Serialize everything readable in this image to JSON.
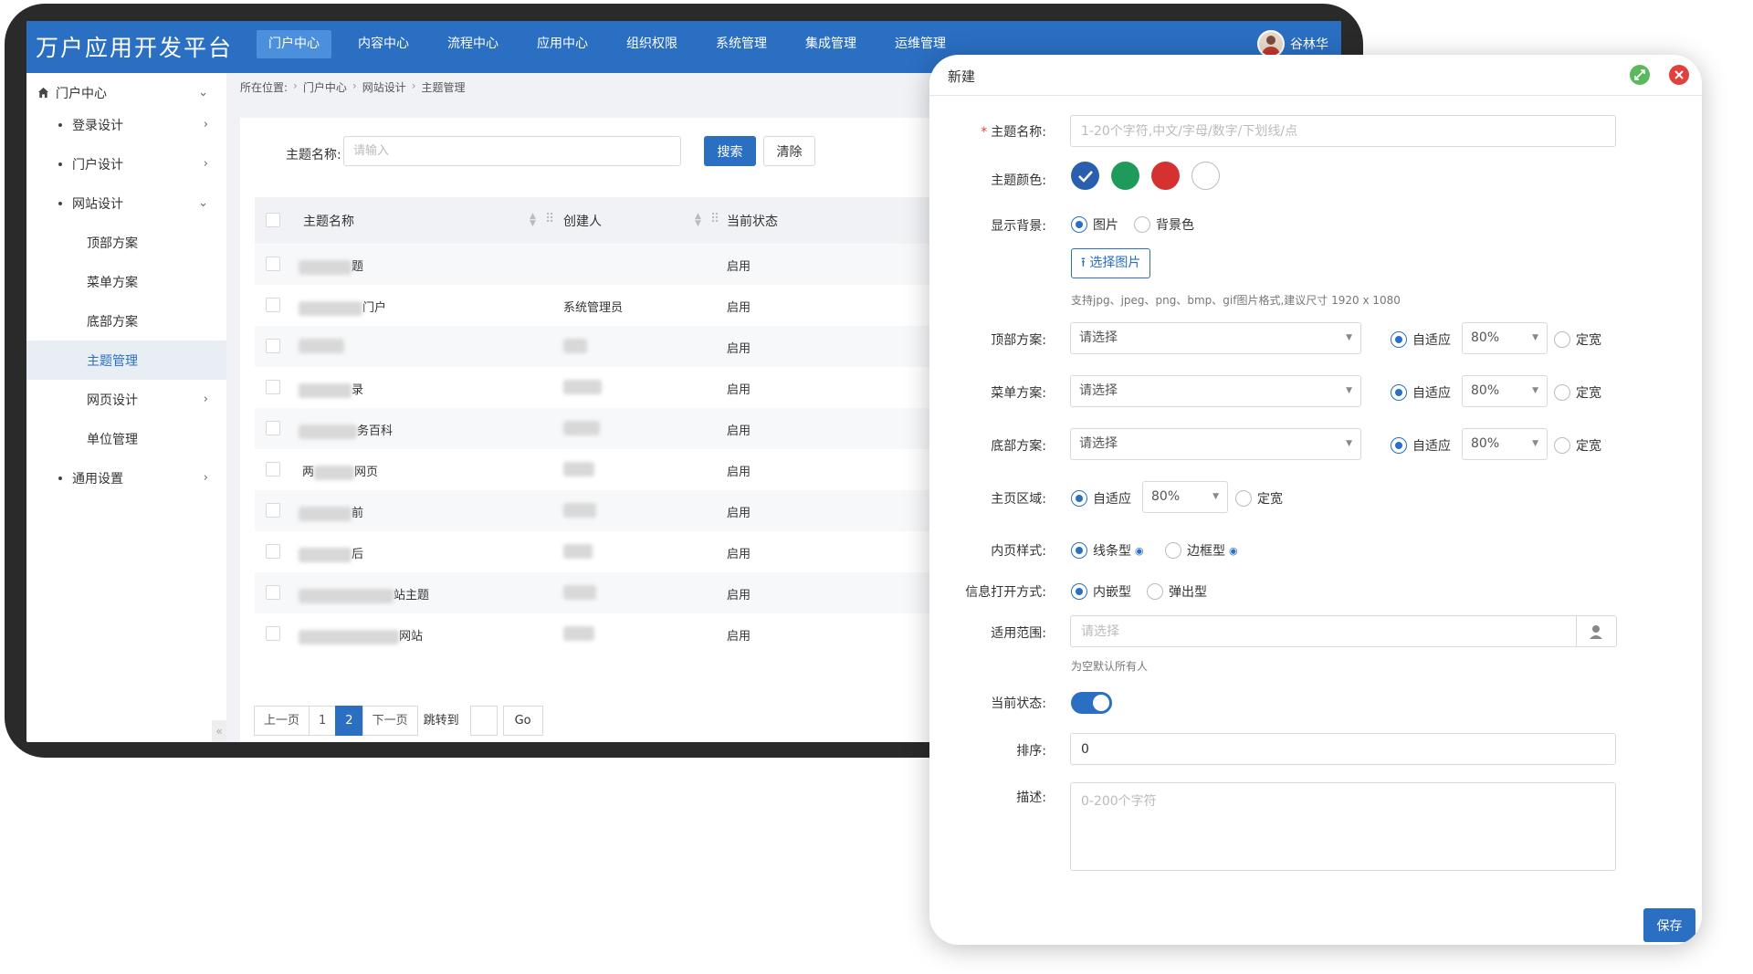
{
  "header": {
    "app_title": "万户应用开发平台",
    "nav": [
      "门户中心",
      "内容中心",
      "流程中心",
      "应用中心",
      "组织权限",
      "系统管理",
      "集成管理",
      "运维管理"
    ],
    "active_nav": "门户中心",
    "user_name": "谷林华"
  },
  "sidebar": {
    "items": [
      {
        "label": "门户中心",
        "level": 0,
        "chevron": "⌄",
        "icon": "home-icon"
      },
      {
        "label": "登录设计",
        "level": 1,
        "chevron": "›"
      },
      {
        "label": "门户设计",
        "level": 1,
        "chevron": "›"
      },
      {
        "label": "网站设计",
        "level": 1,
        "chevron": "⌄"
      },
      {
        "label": "顶部方案",
        "level": 2,
        "chevron": ""
      },
      {
        "label": "菜单方案",
        "level": 2,
        "chevron": ""
      },
      {
        "label": "底部方案",
        "level": 2,
        "chevron": ""
      },
      {
        "label": "主题管理",
        "level": 2,
        "chevron": "",
        "active": true
      },
      {
        "label": "网页设计",
        "level": 2,
        "chevron": "›"
      },
      {
        "label": "单位管理",
        "level": 2,
        "chevron": ""
      },
      {
        "label": "通用设置",
        "level": 1,
        "chevron": "›"
      }
    ],
    "collapse_glyph": "«"
  },
  "breadcrumb": {
    "prefix": "所在位置:",
    "parts": [
      "门户中心",
      "网站设计",
      "主题管理"
    ]
  },
  "search": {
    "label": "主题名称:",
    "placeholder": "请输入",
    "search_button": "搜索",
    "clear_button": "清除"
  },
  "table": {
    "columns": [
      "主题名称",
      "创建人",
      "当前状态"
    ],
    "rows": [
      {
        "name_visible": "题",
        "creator_visible": "",
        "status": "启用"
      },
      {
        "name_visible": "门户",
        "creator_visible": "系统管理员",
        "status": "启用"
      },
      {
        "name_visible": "",
        "creator_visible": "",
        "status": "启用"
      },
      {
        "name_visible": "录",
        "creator_visible": "",
        "status": "启用"
      },
      {
        "name_visible": "务百科",
        "creator_visible": "",
        "status": "启用"
      },
      {
        "name_visible": "两",
        "name_suffix": "网页",
        "creator_visible": "",
        "status": "启用"
      },
      {
        "name_visible": "前",
        "creator_visible": "",
        "status": "启用"
      },
      {
        "name_visible": "后",
        "creator_visible": "",
        "status": "启用"
      },
      {
        "name_visible": "站主题",
        "creator_visible": "",
        "status": "启用"
      },
      {
        "name_visible": "网站",
        "creator_visible": "",
        "status": "启用"
      }
    ]
  },
  "pager": {
    "prev": "上一页",
    "pages": [
      "1",
      "2"
    ],
    "current_page": "2",
    "next": "下一页",
    "jump_label": "跳转到",
    "go": "Go"
  },
  "dialog": {
    "title": "新建",
    "fields": {
      "theme_name": {
        "label": "主题名称:",
        "required": true,
        "placeholder": "1-20个字符,中文/字母/数字/下划线/点"
      },
      "theme_color": {
        "label": "主题颜色:",
        "colors": [
          "#2a5fb0",
          "#1f9a5a",
          "#d63131",
          "#ffffff"
        ],
        "selected_index": 0
      },
      "background": {
        "label": "显示背景:",
        "options": [
          "图片",
          "背景色"
        ],
        "selected": "图片",
        "pick_button": "选择图片",
        "hint": "支持jpg、jpeg、png、bmp、gif图片格式,建议尺寸 1920 x 1080"
      },
      "top_plan": {
        "label": "顶部方案:",
        "placeholder": "请选择",
        "width_options": [
          "自适应",
          "定宽"
        ],
        "selected": "自适应",
        "percent": "80%"
      },
      "menu_plan": {
        "label": "菜单方案:",
        "placeholder": "请选择",
        "width_options": [
          "自适应",
          "定宽"
        ],
        "selected": "自适应",
        "percent": "80%"
      },
      "bottom_plan": {
        "label": "底部方案:",
        "placeholder": "请选择",
        "width_options": [
          "自适应",
          "定宽"
        ],
        "selected": "自适应",
        "percent": "80%"
      },
      "home_area": {
        "label": "主页区域:",
        "width_options": [
          "自适应",
          "定宽"
        ],
        "selected": "自适应",
        "percent": "80%"
      },
      "inner_style": {
        "label": "内页样式:",
        "options": [
          "线条型",
          "边框型"
        ],
        "selected": "线条型"
      },
      "open_mode": {
        "label": "信息打开方式:",
        "options": [
          "内嵌型",
          "弹出型"
        ],
        "selected": "内嵌型"
      },
      "scope": {
        "label": "适用范围:",
        "placeholder": "请选择",
        "hint": "为空默认所有人"
      },
      "status": {
        "label": "当前状态:",
        "enabled": true
      },
      "sort": {
        "label": "排序:",
        "value": "0"
      },
      "desc": {
        "label": "描述:",
        "placeholder": "0-200个字符"
      }
    },
    "save_button": "保存"
  }
}
